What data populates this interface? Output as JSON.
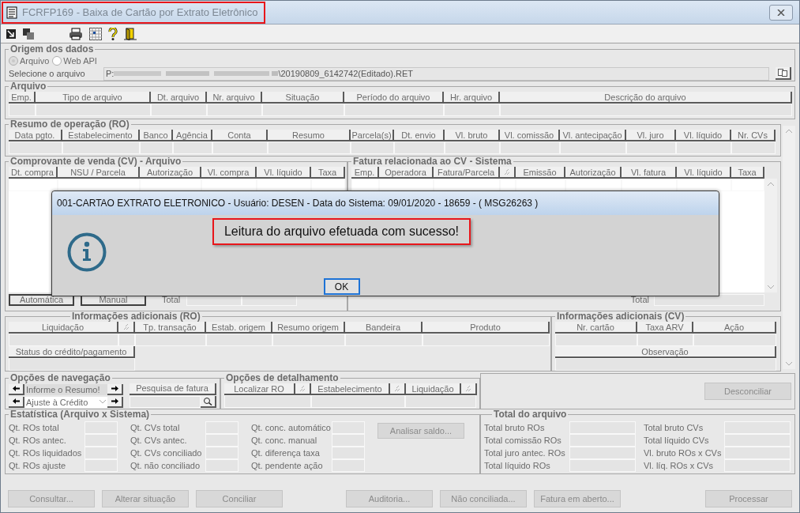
{
  "window": {
    "title": "FCRFP169 - Baixa de Cartão por Extrato Eletrônico"
  },
  "origem": {
    "legend": "Origem dos dados",
    "radios": [
      {
        "label": "Arquivo",
        "selected": true
      },
      {
        "label": "Web API",
        "selected": false
      }
    ],
    "file_label": "Selecione o arquivo",
    "path_prefix": "P:",
    "path_suffix": "\\20190809_6142742(Editado).RET"
  },
  "arquivo": {
    "legend": "Arquivo",
    "columns": [
      {
        "kind": "text",
        "label": "Emp."
      },
      {
        "kind": "text",
        "label": "Tipo de arquivo"
      },
      {
        "kind": "text",
        "label": "Dt. arquivo"
      },
      {
        "kind": "text",
        "label": "Nr. arquivo"
      },
      {
        "kind": "text",
        "label": "Situação"
      },
      {
        "kind": "text",
        "label": "Período do arquivo"
      },
      {
        "kind": "text",
        "label": "Hr. arquivo"
      },
      {
        "kind": "text",
        "label": "Descrição do arquivo"
      }
    ]
  },
  "resumo": {
    "legend": "Resumo de operação (RO)",
    "columns": [
      {
        "kind": "text",
        "label": "Data pgto."
      },
      {
        "kind": "text",
        "label": "Estabelecimento"
      },
      {
        "kind": "text",
        "label": "Banco"
      },
      {
        "kind": "text",
        "label": "Agência"
      },
      {
        "kind": "text",
        "label": "Conta"
      },
      {
        "kind": "text",
        "label": "Resumo"
      },
      {
        "kind": "text",
        "label": "Parcela(s)"
      },
      {
        "kind": "text",
        "label": "Dt. envio"
      },
      {
        "kind": "text",
        "label": "Vl. bruto"
      },
      {
        "kind": "text",
        "label": "Vl. comissão"
      },
      {
        "kind": "text",
        "label": "Vl. antecipação"
      },
      {
        "kind": "text",
        "label": "Vl. juro"
      },
      {
        "kind": "text",
        "label": "Vl. líquido"
      },
      {
        "kind": "text",
        "label": "Nr. CVs"
      }
    ]
  },
  "cv_arquivo": {
    "legend": "Comprovante de venda (CV) - Arquivo",
    "columns": [
      {
        "kind": "text",
        "label": "Dt. compra"
      },
      {
        "kind": "text",
        "label": "NSU / Parcela"
      },
      {
        "kind": "text",
        "label": "Autorização"
      },
      {
        "kind": "text",
        "label": "Vl. compra"
      },
      {
        "kind": "text",
        "label": "Vl. líquido"
      },
      {
        "kind": "text",
        "label": "Taxa"
      }
    ],
    "buttons": [
      "Automática",
      "Manual"
    ],
    "total_label": "Total"
  },
  "fatura": {
    "legend": "Fatura relacionada ao CV - Sistema",
    "columns": [
      {
        "kind": "text",
        "label": "Emp."
      },
      {
        "kind": "text",
        "label": "Operadora"
      },
      {
        "kind": "text",
        "label": "Fatura/Parcela"
      },
      {
        "kind": "sort"
      },
      {
        "kind": "text",
        "label": "Emissão"
      },
      {
        "kind": "text",
        "label": "Autorização"
      },
      {
        "kind": "text",
        "label": "Vl. fatura"
      },
      {
        "kind": "text",
        "label": "Vl. líquido"
      },
      {
        "kind": "text",
        "label": "Taxa"
      }
    ],
    "total_label": "Total"
  },
  "info_ro": {
    "legend": "Informações adicionais (RO)",
    "columns": [
      {
        "kind": "text",
        "label": "Liquidação"
      },
      {
        "kind": "sort"
      },
      {
        "kind": "text",
        "label": "Tp. transação"
      },
      {
        "kind": "text",
        "label": "Estab. origem"
      },
      {
        "kind": "text",
        "label": "Resumo origem"
      },
      {
        "kind": "text",
        "label": "Bandeira"
      },
      {
        "kind": "text",
        "label": "Produto"
      }
    ],
    "status_label": "Status do crédito/pagamento"
  },
  "info_cv": {
    "legend": "Informações adicionais (CV)",
    "columns": [
      {
        "kind": "text",
        "label": "Nr. cartão"
      },
      {
        "kind": "text",
        "label": "Taxa ARV"
      },
      {
        "kind": "text",
        "label": "Ação"
      }
    ],
    "obs_label": "Observação"
  },
  "navegacao": {
    "legend": "Opções de navegação",
    "resumo_value": "Informe o Resumo!",
    "ajuste_value": "Ajuste à Crédito",
    "pesquisa_label": "Pesquisa de fatura"
  },
  "detalhamento": {
    "legend": "Opções de detalhamento",
    "columns": [
      {
        "kind": "text",
        "label": "Localizar RO"
      },
      {
        "kind": "sort"
      },
      {
        "kind": "text",
        "label": "Estabelecimento"
      },
      {
        "kind": "sort"
      },
      {
        "kind": "text",
        "label": "Liquidação"
      },
      {
        "kind": "sort"
      }
    ]
  },
  "desconciliar": "Desconciliar",
  "estatistica": {
    "legend": "Estatística (Arquivo x Sistema)",
    "groups": [
      [
        "Qt. ROs total",
        "Qt. ROs antec.",
        "Qt. ROs liquidados",
        "Qt. ROs ajuste"
      ],
      [
        "Qt. CVs total",
        "Qt. CVs antec.",
        "Qt. CVs conciliado",
        "Qt. não conciliado"
      ],
      [
        "Qt. conc. automático",
        "Qt. conc. manual",
        "Qt. diferença taxa",
        "Qt. pendente ação"
      ]
    ],
    "analisar": "Analisar saldo..."
  },
  "total": {
    "legend": "Total do arquivo",
    "groups": [
      [
        "Total bruto ROs",
        "Total comissão ROs",
        "Total juro antec. ROs",
        "Total líquido ROs"
      ],
      [
        "Total bruto CVs",
        "Total líquido CVs",
        "Vl. bruto ROs x CVs",
        "Vl. líq. ROs x CVs"
      ]
    ]
  },
  "actions": [
    "Consultar...",
    "Alterar situação",
    "Conciliar",
    "Auditoria...",
    "Não conciliada...",
    "Fatura em aberto...",
    "Processar"
  ],
  "dialog": {
    "title": "001-CARTAO EXTRATO ELETRONICO - Usuário: DESEN - Data do Sistema: 09/01/2020 - 18659 - ( MSG26263 )",
    "message": "Leitura do arquivo efetuada com sucesso!",
    "ok": "OK"
  }
}
